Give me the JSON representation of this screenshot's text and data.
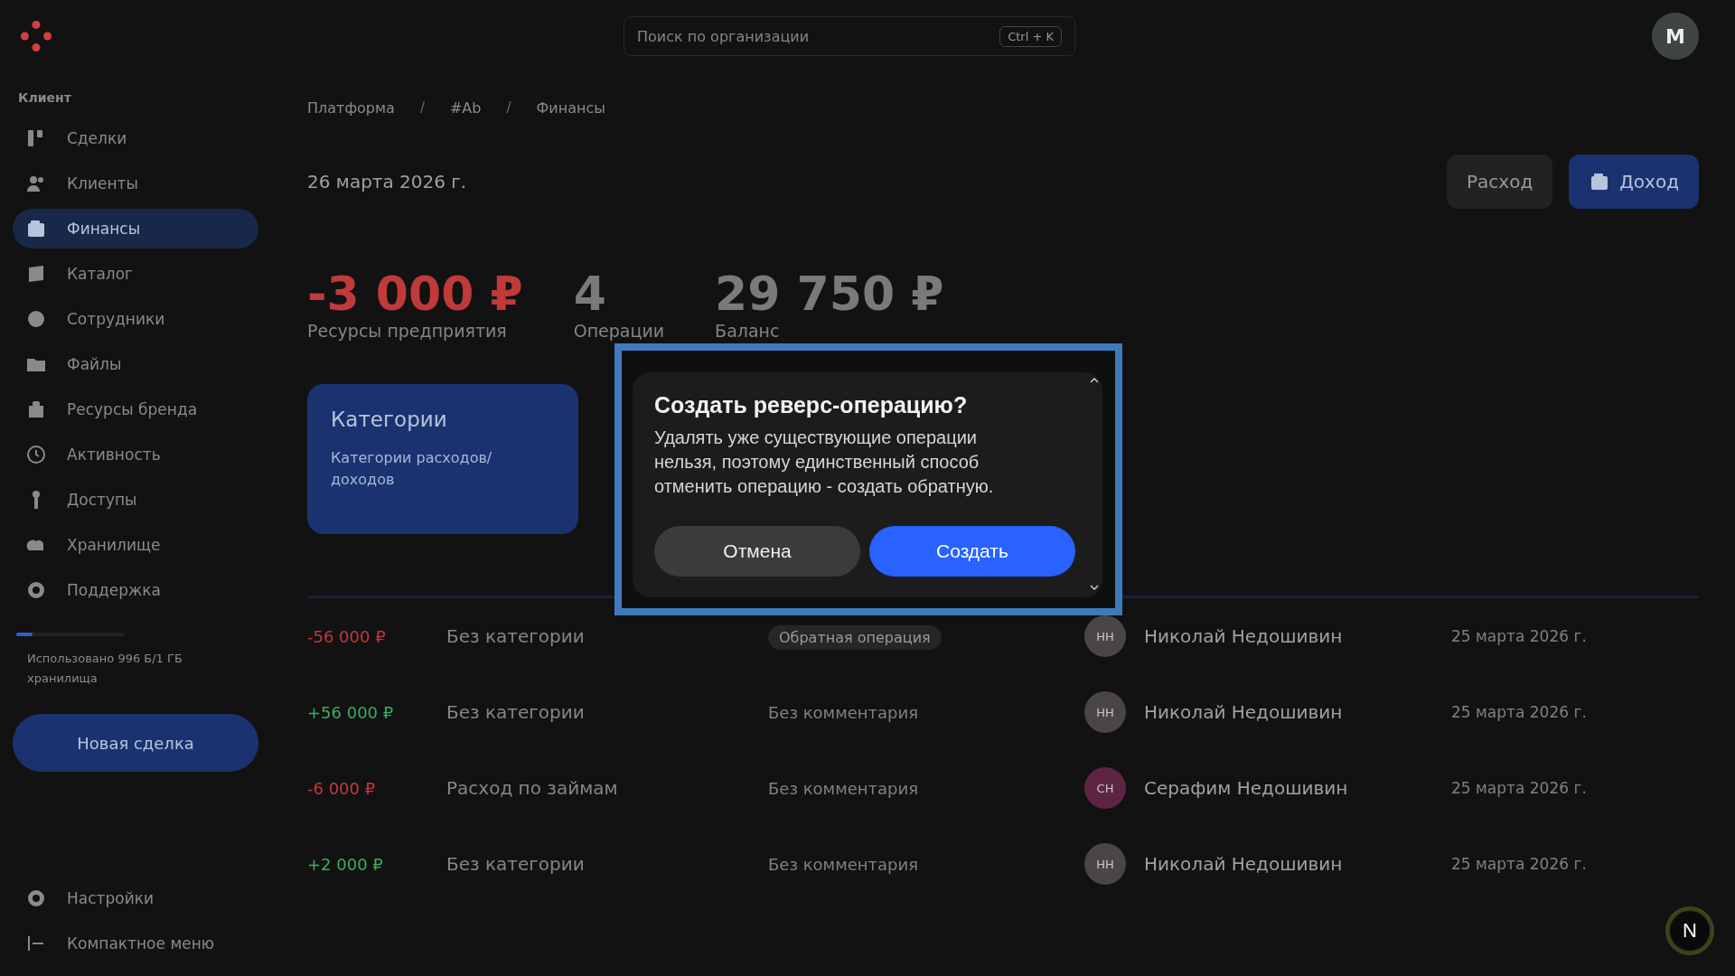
{
  "sidebar": {
    "section": "Клиент",
    "items": [
      {
        "label": "Сделки",
        "selected": false
      },
      {
        "label": "Клиенты",
        "selected": false
      },
      {
        "label": "Финансы",
        "selected": true
      },
      {
        "label": "Каталог",
        "selected": false
      },
      {
        "label": "Сотрудники",
        "selected": false
      },
      {
        "label": "Файлы",
        "selected": false
      },
      {
        "label": "Ресурсы бренда",
        "selected": false
      },
      {
        "label": "Активность",
        "selected": false
      },
      {
        "label": "Доступы",
        "selected": false
      },
      {
        "label": "Хранилище",
        "selected": false
      },
      {
        "label": "Поддержка",
        "selected": false
      }
    ],
    "storage": {
      "level": 0.15,
      "text": "Использовано 996 Б/1 ГБ хранилища"
    },
    "new_button": "Новая сделка",
    "footer": [
      {
        "label": "Настройки"
      },
      {
        "label": "Компактное меню"
      }
    ]
  },
  "topbar": {
    "search": {
      "placeholder": "Поиск по организации",
      "shortcut": "Ctrl + K"
    },
    "avatar": "М"
  },
  "breadcrumbs": [
    {
      "kind": "link",
      "text": "Платформа"
    },
    {
      "kind": "separator",
      "text": "/"
    },
    {
      "kind": "link",
      "text": "#Ab"
    },
    {
      "kind": "separator",
      "text": "/"
    },
    {
      "kind": "link",
      "text": "Финансы"
    }
  ],
  "date": "26 марта 2026 г.",
  "actions": [
    {
      "label": "Расход",
      "primary": false
    },
    {
      "label": "Доход",
      "primary": true
    }
  ],
  "stats": [
    {
      "value": "-3 000 ₽",
      "label": "Ресурсы предприятия",
      "kind": "expense"
    },
    {
      "value": "4",
      "label": "Операции",
      "kind": "neutral"
    },
    {
      "value": "29 750 ₽",
      "label": "Баланс",
      "kind": "neutral"
    }
  ],
  "category_card": {
    "title": "Категории",
    "text": "Категории расходов/доходов"
  },
  "rows": [
    {
      "amount": "-56 000 ₽",
      "kind": "expense",
      "category": "Без категории",
      "tag": "Обратная операция",
      "initials": "НН",
      "color": "#4a4646",
      "person": "Николай Недошивин",
      "date": "25 марта 2026 г."
    },
    {
      "amount": "+56 000 ₽",
      "kind": "income",
      "category": "Без категории",
      "comment": "Без комментария",
      "initials": "НН",
      "color": "#4a4646",
      "person": "Николай Недошивин",
      "date": "25 марта 2026 г."
    },
    {
      "amount": "-6 000 ₽",
      "kind": "expense",
      "category": "Расход по займам",
      "comment": "Без комментария",
      "initials": "СН",
      "color": "#5e2444",
      "person": "Серафим Недошивин",
      "date": "25 марта 2026 г."
    },
    {
      "amount": "+2 000 ₽",
      "kind": "income",
      "category": "Без категории",
      "comment": "Без комментария",
      "initials": "НН",
      "color": "#4a4646",
      "person": "Николай Недошивин",
      "date": "25 марта 2026 г."
    }
  ],
  "dialog": {
    "title": "Создать реверс-операцию?",
    "text": "Удалять уже существующие операции нельзя, поэтому единственный способ отменить операцию - создать обратную.",
    "buttons": [
      {
        "label": "Отмена",
        "primary": false
      },
      {
        "label": "Создать",
        "primary": true
      }
    ]
  },
  "dev_badge": "N"
}
